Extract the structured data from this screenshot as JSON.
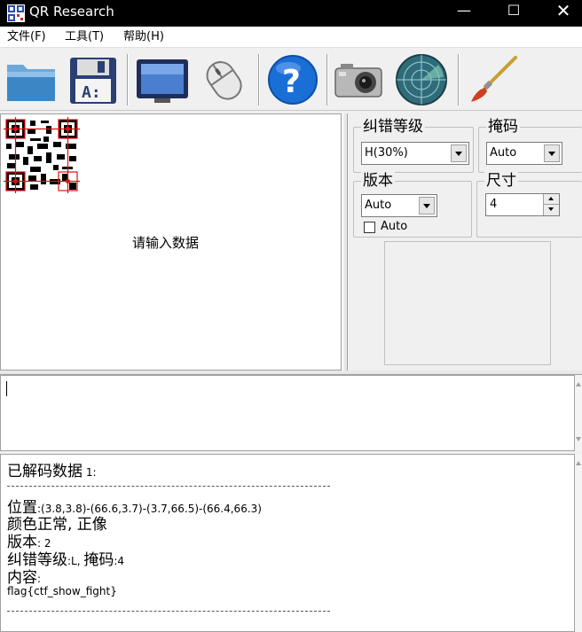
{
  "window": {
    "title": "QR Research",
    "controls": {
      "minimize": "—",
      "maximize": "☐",
      "close": "✕"
    }
  },
  "menu": [
    "文件(F)",
    "工具(T)",
    "帮助(H)"
  ],
  "toolbar": {
    "icons": [
      "folder-icon",
      "save-icon",
      "monitor-icon",
      "mouse-icon",
      "help-icon",
      "camera-icon",
      "globe-icon",
      "brush-icon"
    ]
  },
  "preview": {
    "hint": "请输入数据"
  },
  "settings": {
    "ecc_label": "纠错等级",
    "ecc_value": "H(30%)",
    "mask_label": "掩码",
    "mask_value": "Auto",
    "version_label": "版本",
    "version_value": "Auto",
    "version_auto_label": "Auto",
    "size_label": "尺寸",
    "size_value": "4"
  },
  "output": {
    "header_main": "已解码数据",
    "header_num": " 1:",
    "position_label": "位置",
    "position_value": ":(3.8,3.8)-(66.6,3.7)-(3.7,66.5)-(66.4,66.3)",
    "color_line": "颜色正常, 正像",
    "version_label": "版本",
    "version_value": ": 2",
    "ecc_label": "纠错等级",
    "ecc_value": ":L, ",
    "mask_label": "掩码",
    "mask_value": ":4",
    "content_label": "内容",
    "content_colon": ":",
    "content_value": "flag{ctf_show_fight}"
  },
  "colors": {
    "titlebar": "#000000",
    "help_blue": "#1a6fd6",
    "globe_teal": "#2f6c7a"
  }
}
